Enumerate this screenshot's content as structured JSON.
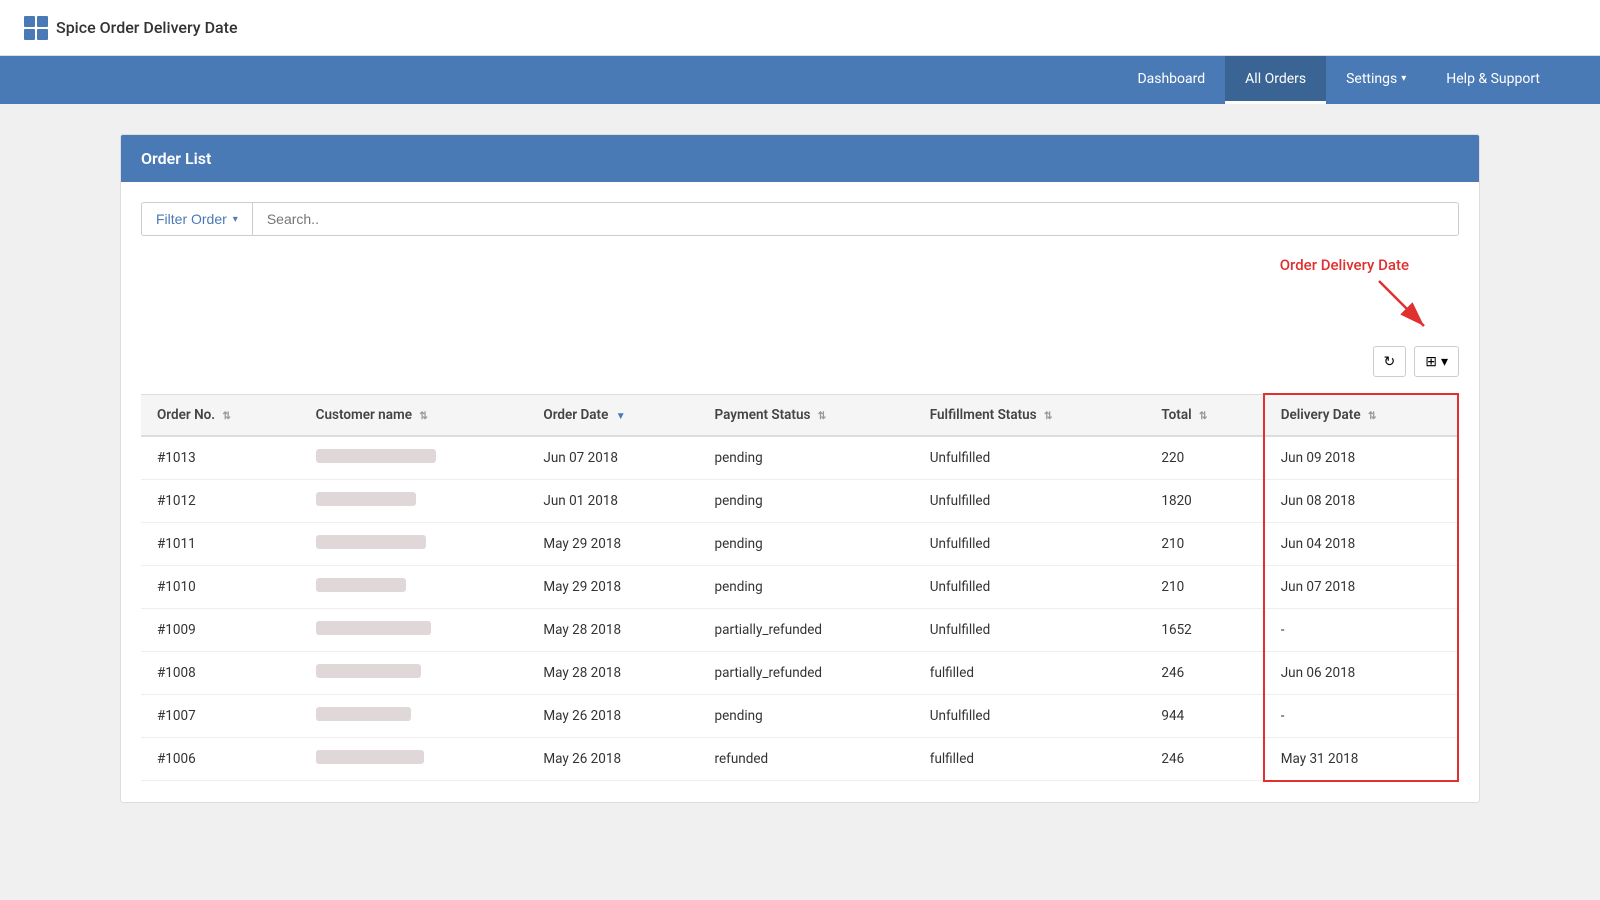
{
  "app": {
    "title": "Spice Order Delivery Date"
  },
  "nav": {
    "items": [
      {
        "label": "Dashboard",
        "active": false
      },
      {
        "label": "All Orders",
        "active": true
      },
      {
        "label": "Settings",
        "active": false,
        "hasChevron": true
      },
      {
        "label": "Help & Support",
        "active": false
      }
    ]
  },
  "card": {
    "title": "Order List"
  },
  "filter": {
    "button_label": "Filter Order",
    "search_placeholder": "Search.."
  },
  "annotation": {
    "label": "Order Delivery Date"
  },
  "toolbar": {
    "refresh_icon": "↻",
    "columns_icon": "⊞"
  },
  "table": {
    "columns": [
      {
        "label": "Order No.",
        "key": "order_no",
        "sortable": true,
        "sorted": false
      },
      {
        "label": "Customer name",
        "key": "customer_name",
        "sortable": true,
        "sorted": false
      },
      {
        "label": "Order Date",
        "key": "order_date",
        "sortable": true,
        "sorted": true
      },
      {
        "label": "Payment Status",
        "key": "payment_status",
        "sortable": true,
        "sorted": false
      },
      {
        "label": "Fulfillment Status",
        "key": "fulfillment_status",
        "sortable": true,
        "sorted": false
      },
      {
        "label": "Total",
        "key": "total",
        "sortable": true,
        "sorted": false
      },
      {
        "label": "Delivery Date",
        "key": "delivery_date",
        "sortable": true,
        "sorted": false
      }
    ],
    "rows": [
      {
        "order_no": "#1013",
        "customer_name_width": 120,
        "order_date": "Jun 07 2018",
        "payment_status": "pending",
        "fulfillment_status": "Unfulfilled",
        "total": "220",
        "delivery_date": "Jun 09 2018"
      },
      {
        "order_no": "#1012",
        "customer_name_width": 100,
        "order_date": "Jun 01 2018",
        "payment_status": "pending",
        "fulfillment_status": "Unfulfilled",
        "total": "1820",
        "delivery_date": "Jun 08 2018"
      },
      {
        "order_no": "#1011",
        "customer_name_width": 110,
        "order_date": "May 29 2018",
        "payment_status": "pending",
        "fulfillment_status": "Unfulfilled",
        "total": "210",
        "delivery_date": "Jun 04 2018"
      },
      {
        "order_no": "#1010",
        "customer_name_width": 90,
        "order_date": "May 29 2018",
        "payment_status": "pending",
        "fulfillment_status": "Unfulfilled",
        "total": "210",
        "delivery_date": "Jun 07 2018"
      },
      {
        "order_no": "#1009",
        "customer_name_width": 115,
        "order_date": "May 28 2018",
        "payment_status": "partially_refunded",
        "fulfillment_status": "Unfulfilled",
        "total": "1652",
        "delivery_date": "-"
      },
      {
        "order_no": "#1008",
        "customer_name_width": 105,
        "order_date": "May 28 2018",
        "payment_status": "partially_refunded",
        "fulfillment_status": "fulfilled",
        "total": "246",
        "delivery_date": "Jun 06 2018"
      },
      {
        "order_no": "#1007",
        "customer_name_width": 95,
        "order_date": "May 26 2018",
        "payment_status": "pending",
        "fulfillment_status": "Unfulfilled",
        "total": "944",
        "delivery_date": "-"
      },
      {
        "order_no": "#1006",
        "customer_name_width": 108,
        "order_date": "May 26 2018",
        "payment_status": "refunded",
        "fulfillment_status": "fulfilled",
        "total": "246",
        "delivery_date": "May 31 2018"
      }
    ]
  }
}
